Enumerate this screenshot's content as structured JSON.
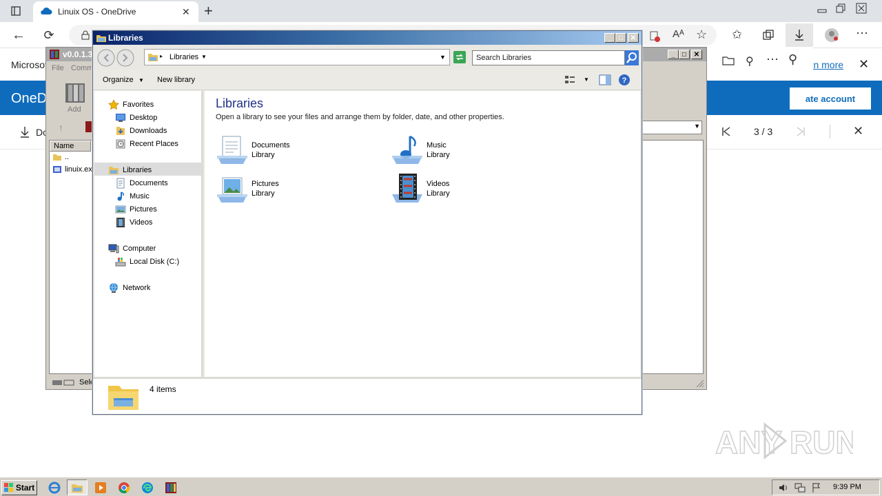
{
  "browser": {
    "tab_title": "Linuix OS - OneDrive",
    "new_tab": "+",
    "read_aloud": "Aᴬ"
  },
  "onedrive": {
    "left_text": "Microsof",
    "brand": "OneD",
    "learn_more": "arn more",
    "create_account": "ate account",
    "download_label": "Do",
    "pager": "3 / 3"
  },
  "winrar": {
    "title": "v0.0.1.3",
    "menu_file": "File",
    "menu_commands": "Comm",
    "add_label": "Add",
    "col_name": "Name",
    "rows": [
      "..",
      "linuix.ex"
    ],
    "status": "Sele"
  },
  "explorer": {
    "title": "Libraries",
    "breadcrumb": "Libraries",
    "search_placeholder": "Search Libraries",
    "organize": "Organize",
    "new_library": "New library",
    "heading": "Libraries",
    "subtitle": "Open a library to see your files and arrange them by folder, date, and other properties.",
    "nav": {
      "favorites": "Favorites",
      "desktop": "Desktop",
      "downloads": "Downloads",
      "recent_places": "Recent Places",
      "libraries": "Libraries",
      "documents": "Documents",
      "music": "Music",
      "pictures": "Pictures",
      "videos": "Videos",
      "computer": "Computer",
      "local_disk": "Local Disk (C:)",
      "network": "Network"
    },
    "libraries": [
      {
        "name": "Documents",
        "type": "Library"
      },
      {
        "name": "Music",
        "type": "Library"
      },
      {
        "name": "Pictures",
        "type": "Library"
      },
      {
        "name": "Videos",
        "type": "Library"
      }
    ],
    "item_count": "4 items"
  },
  "taskbar": {
    "start": "Start",
    "clock": "9:39 PM"
  },
  "watermark": "ANY RUN",
  "colors": {
    "onedrive_blue": "#0f6cbd",
    "title_active": "#0a246a",
    "taskbar": "#d4d0c8"
  }
}
